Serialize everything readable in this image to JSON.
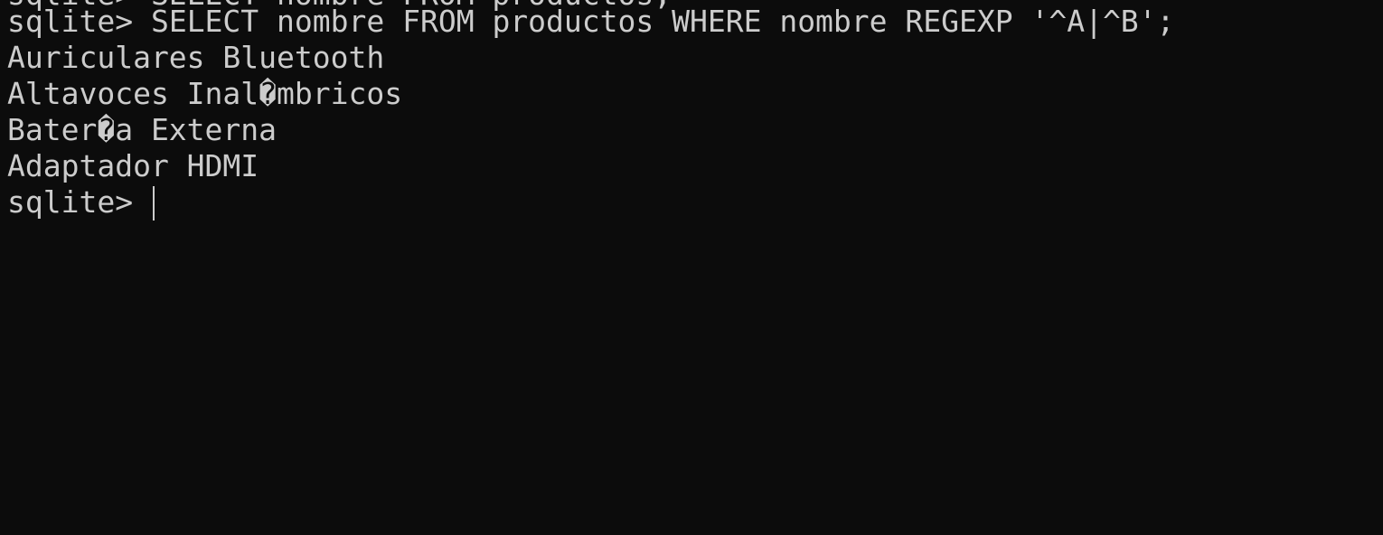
{
  "terminal": {
    "previous_line": "sqlite> SELECT nombre FROM productos;",
    "prompt": "sqlite> ",
    "command": "SELECT nombre FROM productos WHERE nombre REGEXP '^A|^B';",
    "results": [
      "Auriculares Bluetooth",
      "Altavoces Inal�mbricos",
      "Bater�a Externa",
      "Adaptador HDMI"
    ],
    "current_prompt": "sqlite> ",
    "colors": {
      "background": "#0c0c0c",
      "foreground": "#cccccc"
    }
  }
}
